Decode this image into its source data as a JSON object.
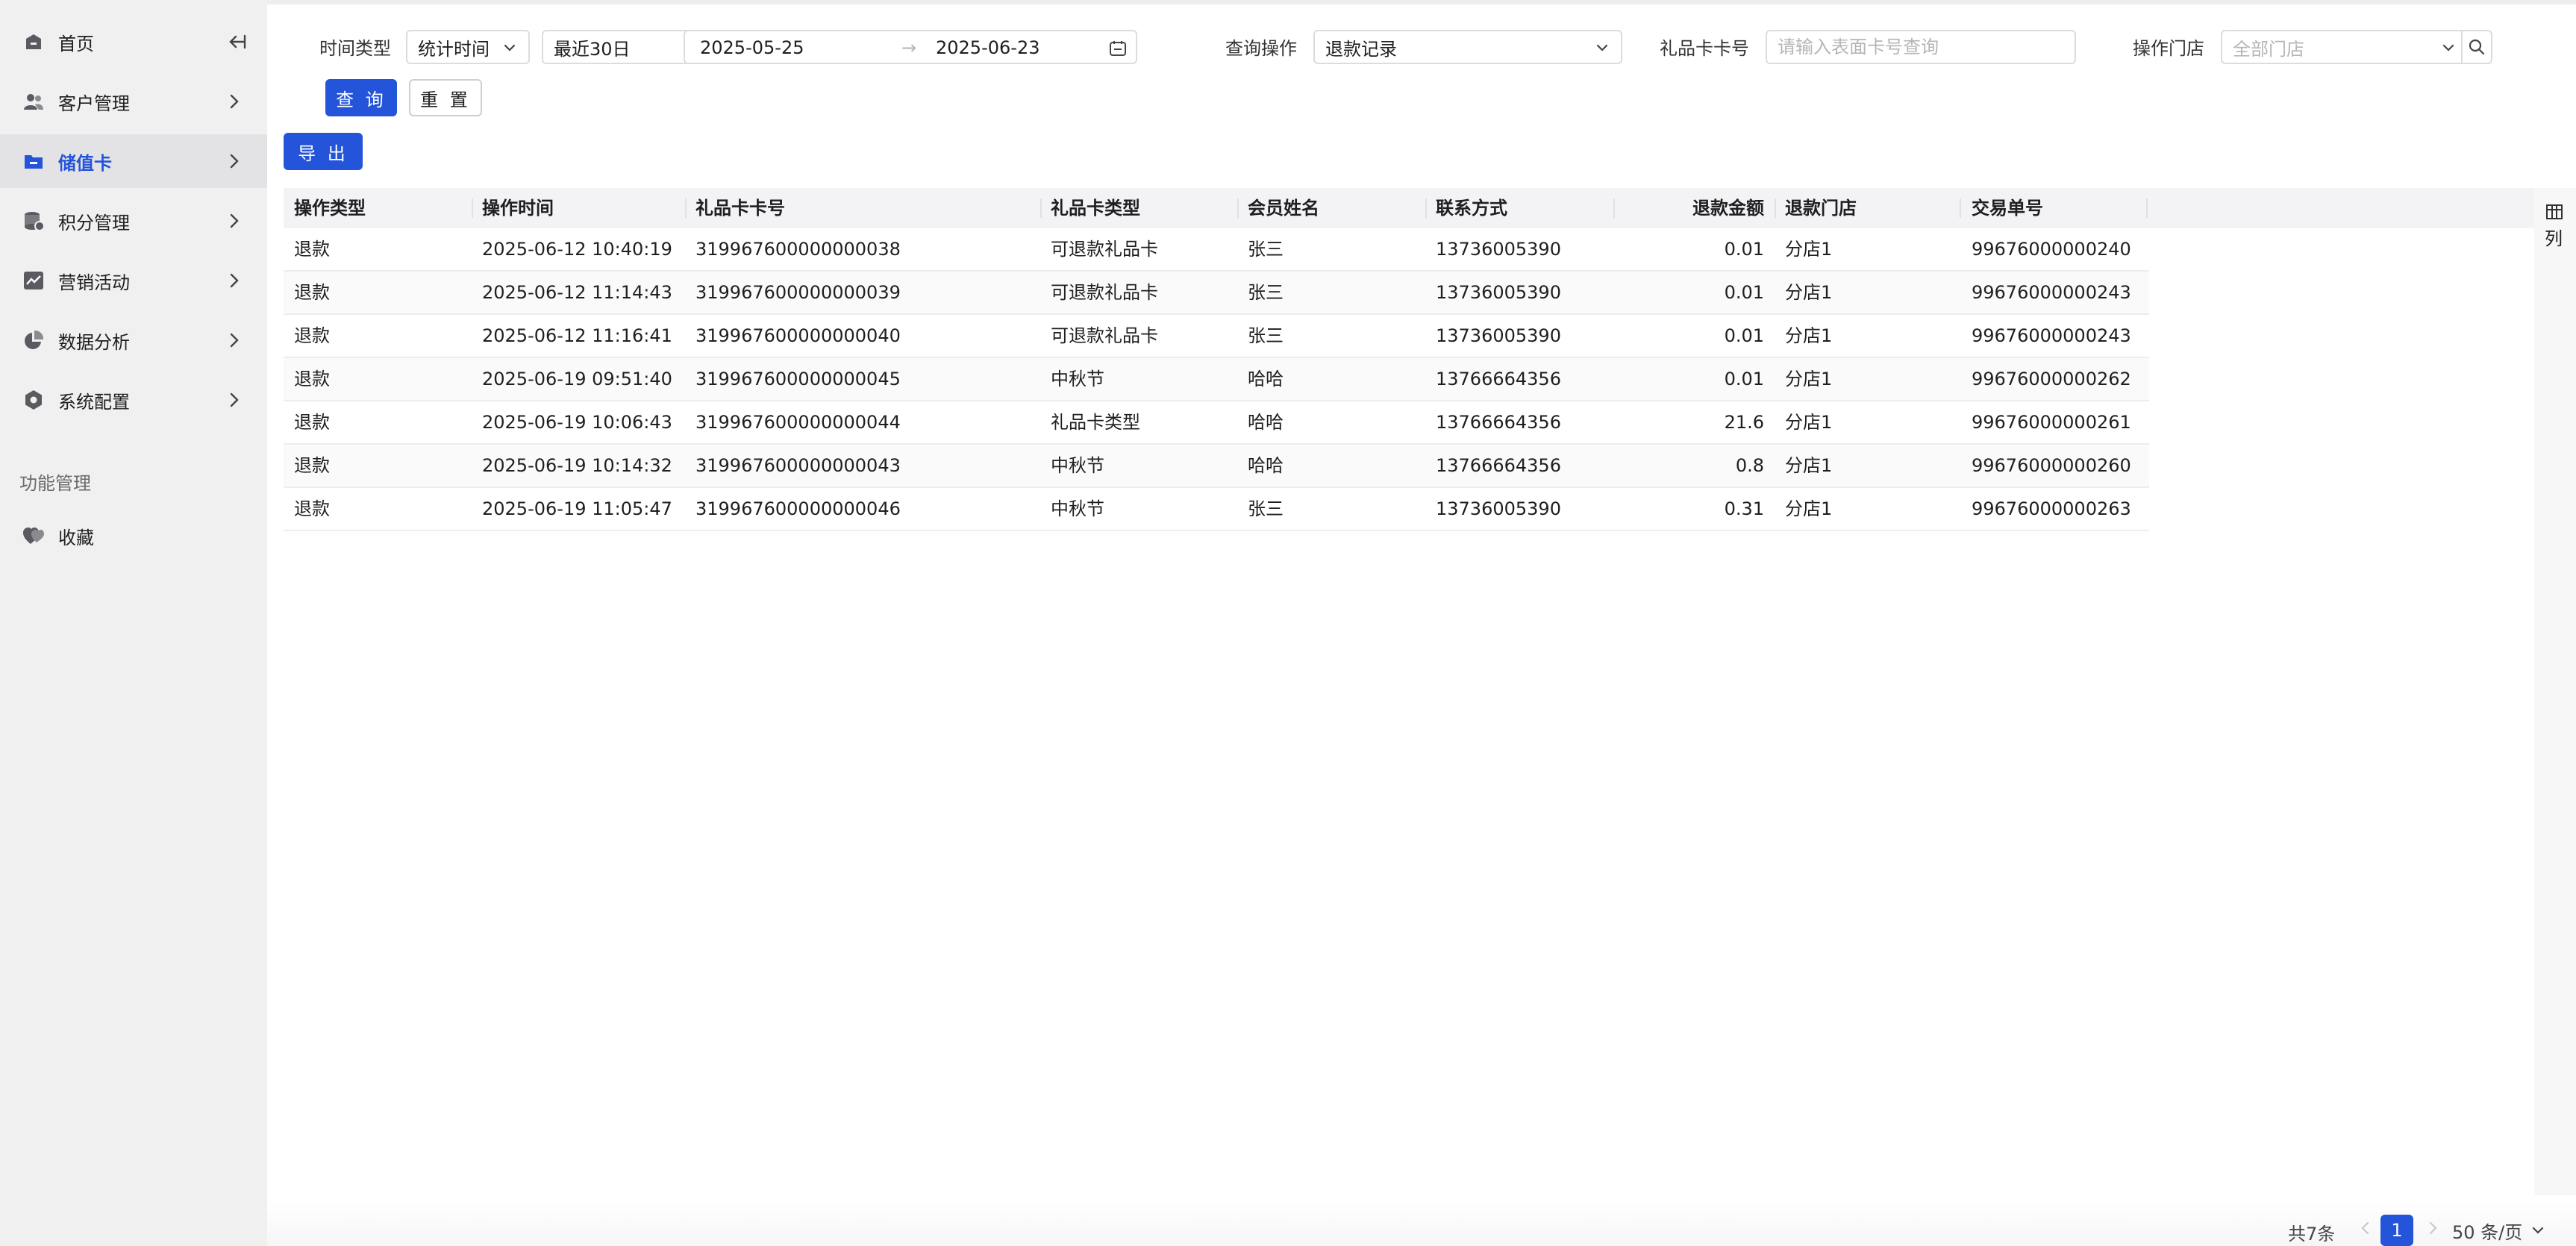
{
  "sidebar": {
    "items": [
      {
        "label": "首页"
      },
      {
        "label": "客户管理"
      },
      {
        "label": "储值卡"
      },
      {
        "label": "积分管理"
      },
      {
        "label": "营销活动"
      },
      {
        "label": "数据分析"
      },
      {
        "label": "系统配置"
      }
    ],
    "section_title": "功能管理",
    "favorites_label": "收藏",
    "active_color": "#2354d9"
  },
  "filters": {
    "time_type_label": "时间类型",
    "time_type_value": "统计时间",
    "range_preset_value": "最近30日",
    "date_start": "2025-05-25",
    "date_separator": "→",
    "date_end": "2025-06-23",
    "query_op_label": "查询操作",
    "query_op_value": "退款记录",
    "card_no_label": "礼品卡卡号",
    "card_no_placeholder": "请输入表面卡号查询",
    "store_label": "操作门店",
    "store_placeholder": "全部门店",
    "query_button": "查 询",
    "reset_button": "重 置",
    "export_button": "导 出"
  },
  "table": {
    "columns": [
      "操作类型",
      "操作时间",
      "礼品卡卡号",
      "礼品卡类型",
      "会员姓名",
      "联系方式",
      "退款金额",
      "退款门店",
      "交易单号"
    ],
    "rows": [
      [
        "退款",
        "2025-06-12 10:40:19",
        "319967600000000038",
        "可退款礼品卡",
        "张三",
        "13736005390",
        "0.01",
        "分店1",
        "99676000000240"
      ],
      [
        "退款",
        "2025-06-12 11:14:43",
        "319967600000000039",
        "可退款礼品卡",
        "张三",
        "13736005390",
        "0.01",
        "分店1",
        "99676000000243"
      ],
      [
        "退款",
        "2025-06-12 11:16:41",
        "319967600000000040",
        "可退款礼品卡",
        "张三",
        "13736005390",
        "0.01",
        "分店1",
        "99676000000243"
      ],
      [
        "退款",
        "2025-06-19 09:51:40",
        "319967600000000045",
        "中秋节",
        "哈哈",
        "13766664356",
        "0.01",
        "分店1",
        "99676000000262"
      ],
      [
        "退款",
        "2025-06-19 10:06:43",
        "319967600000000044",
        "礼品卡类型",
        "哈哈",
        "13766664356",
        "21.6",
        "分店1",
        "99676000000261"
      ],
      [
        "退款",
        "2025-06-19 10:14:32",
        "319967600000000043",
        "中秋节",
        "哈哈",
        "13766664356",
        "0.8",
        "分店1",
        "99676000000260"
      ],
      [
        "退款",
        "2025-06-19 11:05:47",
        "319967600000000046",
        "中秋节",
        "张三",
        "13736005390",
        "0.31",
        "分店1",
        "99676000000263"
      ]
    ],
    "column_settings_label": "列"
  },
  "pagination": {
    "total_text": "共7条",
    "current_page": "1",
    "page_size": "50 条/页"
  }
}
